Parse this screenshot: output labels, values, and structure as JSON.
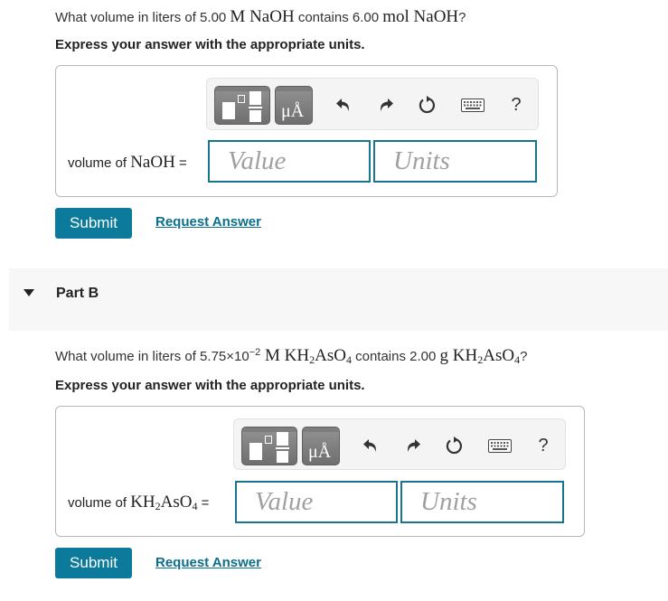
{
  "part_a": {
    "question": {
      "pre": "What volume in liters of 5.00 ",
      "m1": "M NaOH",
      "mid": " contains 6.00 ",
      "m2": "mol NaOH",
      "post": "?"
    },
    "instruction": "Express your answer with the appropriate units.",
    "answer_label_pre": "volume of ",
    "answer_label_formula": "NaOH",
    "answer_label_eq": " =",
    "value_placeholder": "Value",
    "units_placeholder": "Units",
    "submit_label": "Submit",
    "request_answer_label": "Request Answer"
  },
  "part_b": {
    "header": "Part B",
    "toggle_icon": "triangle-down-icon",
    "question": {
      "pre": "What volume in liters of 5.75×10",
      "exp": "−2",
      "m1a": " M KH",
      "m1s1": "2",
      "m1b": "AsO",
      "m1s2": "4",
      "mid": " contains 2.00 ",
      "m2a": "g KH",
      "m2s1": "2",
      "m2b": "AsO",
      "m2s2": "4",
      "post": "?"
    },
    "instruction": "Express your answer with the appropriate units.",
    "answer_label_pre": "volume of ",
    "answer_label_f1": "KH",
    "answer_label_s1": "2",
    "answer_label_f2": "AsO",
    "answer_label_s2": "4",
    "answer_label_eq": " =",
    "value_placeholder": "Value",
    "units_placeholder": "Units",
    "submit_label": "Submit",
    "request_answer_label": "Request Answer"
  },
  "toolbar": {
    "templates_icon": "templates-icon",
    "units_glyph": "μÅ",
    "undo_icon": "undo-icon",
    "redo_icon": "redo-icon",
    "reset_icon": "reset-icon",
    "keyboard_icon": "keyboard-icon",
    "help_glyph": "?"
  },
  "colors": {
    "accent": "#0b7a9b",
    "input_border": "#18758d",
    "link": "#0b6f8c"
  }
}
